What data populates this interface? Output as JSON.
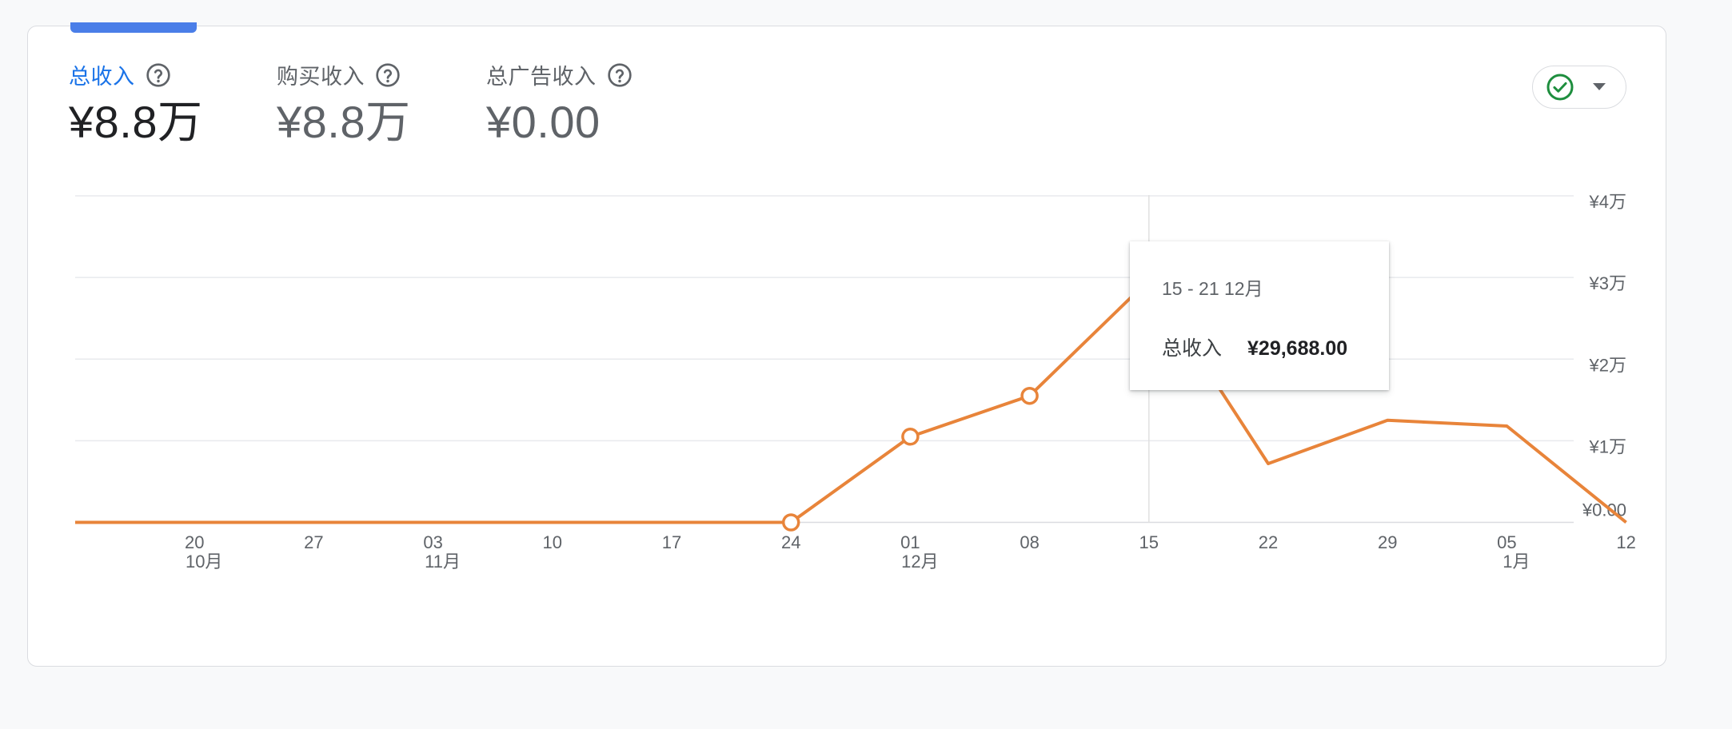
{
  "metrics": [
    {
      "label": "总收入",
      "value": "¥8.8万",
      "active": true
    },
    {
      "label": "购买收入",
      "value": "¥8.8万",
      "active": false
    },
    {
      "label": "总广告收入",
      "value": "¥0.00",
      "active": false
    }
  ],
  "icons": {
    "help": "help-circle-icon",
    "check": "check-circle-icon",
    "caret": "caret-down-icon"
  },
  "colors": {
    "accent": "#1a73e8",
    "series": "#e8843a",
    "check": "#1e8e3e"
  },
  "tooltip": {
    "date": "15 - 21 12月",
    "label": "总收入",
    "value": "¥29,688.00"
  },
  "chart_data": {
    "type": "line",
    "x": [
      "10-13",
      "10-20",
      "10-27",
      "11-03",
      "11-10",
      "11-17",
      "11-24",
      "12-01",
      "12-08",
      "12-15",
      "12-22",
      "12-29",
      "01-05",
      "01-12"
    ],
    "x_tick_labels": [
      {
        "day": "20",
        "month": "10月"
      },
      {
        "day": "27",
        "month": ""
      },
      {
        "day": "03",
        "month": "11月"
      },
      {
        "day": "10",
        "month": ""
      },
      {
        "day": "17",
        "month": ""
      },
      {
        "day": "24",
        "month": ""
      },
      {
        "day": "01",
        "month": "12月"
      },
      {
        "day": "08",
        "month": ""
      },
      {
        "day": "15",
        "month": ""
      },
      {
        "day": "22",
        "month": ""
      },
      {
        "day": "29",
        "month": ""
      },
      {
        "day": "05",
        "month": "1月"
      },
      {
        "day": "12",
        "month": ""
      }
    ],
    "series": [
      {
        "name": "总收入",
        "values": [
          0,
          0,
          0,
          0,
          0,
          0,
          0,
          10500,
          15500,
          29688,
          7200,
          12500,
          11800,
          0
        ],
        "markers": [
          false,
          false,
          false,
          false,
          false,
          false,
          true,
          true,
          true,
          true,
          false,
          false,
          false,
          false
        ]
      }
    ],
    "y_ticks": [
      {
        "value": 40000,
        "label": "¥4万"
      },
      {
        "value": 30000,
        "label": "¥3万"
      },
      {
        "value": 20000,
        "label": "¥2万"
      },
      {
        "value": 10000,
        "label": "¥1万"
      },
      {
        "value": 0,
        "label": "¥0.00"
      }
    ],
    "ylim": [
      0,
      40000
    ],
    "grid": true,
    "highlighted_x": "12-15"
  }
}
